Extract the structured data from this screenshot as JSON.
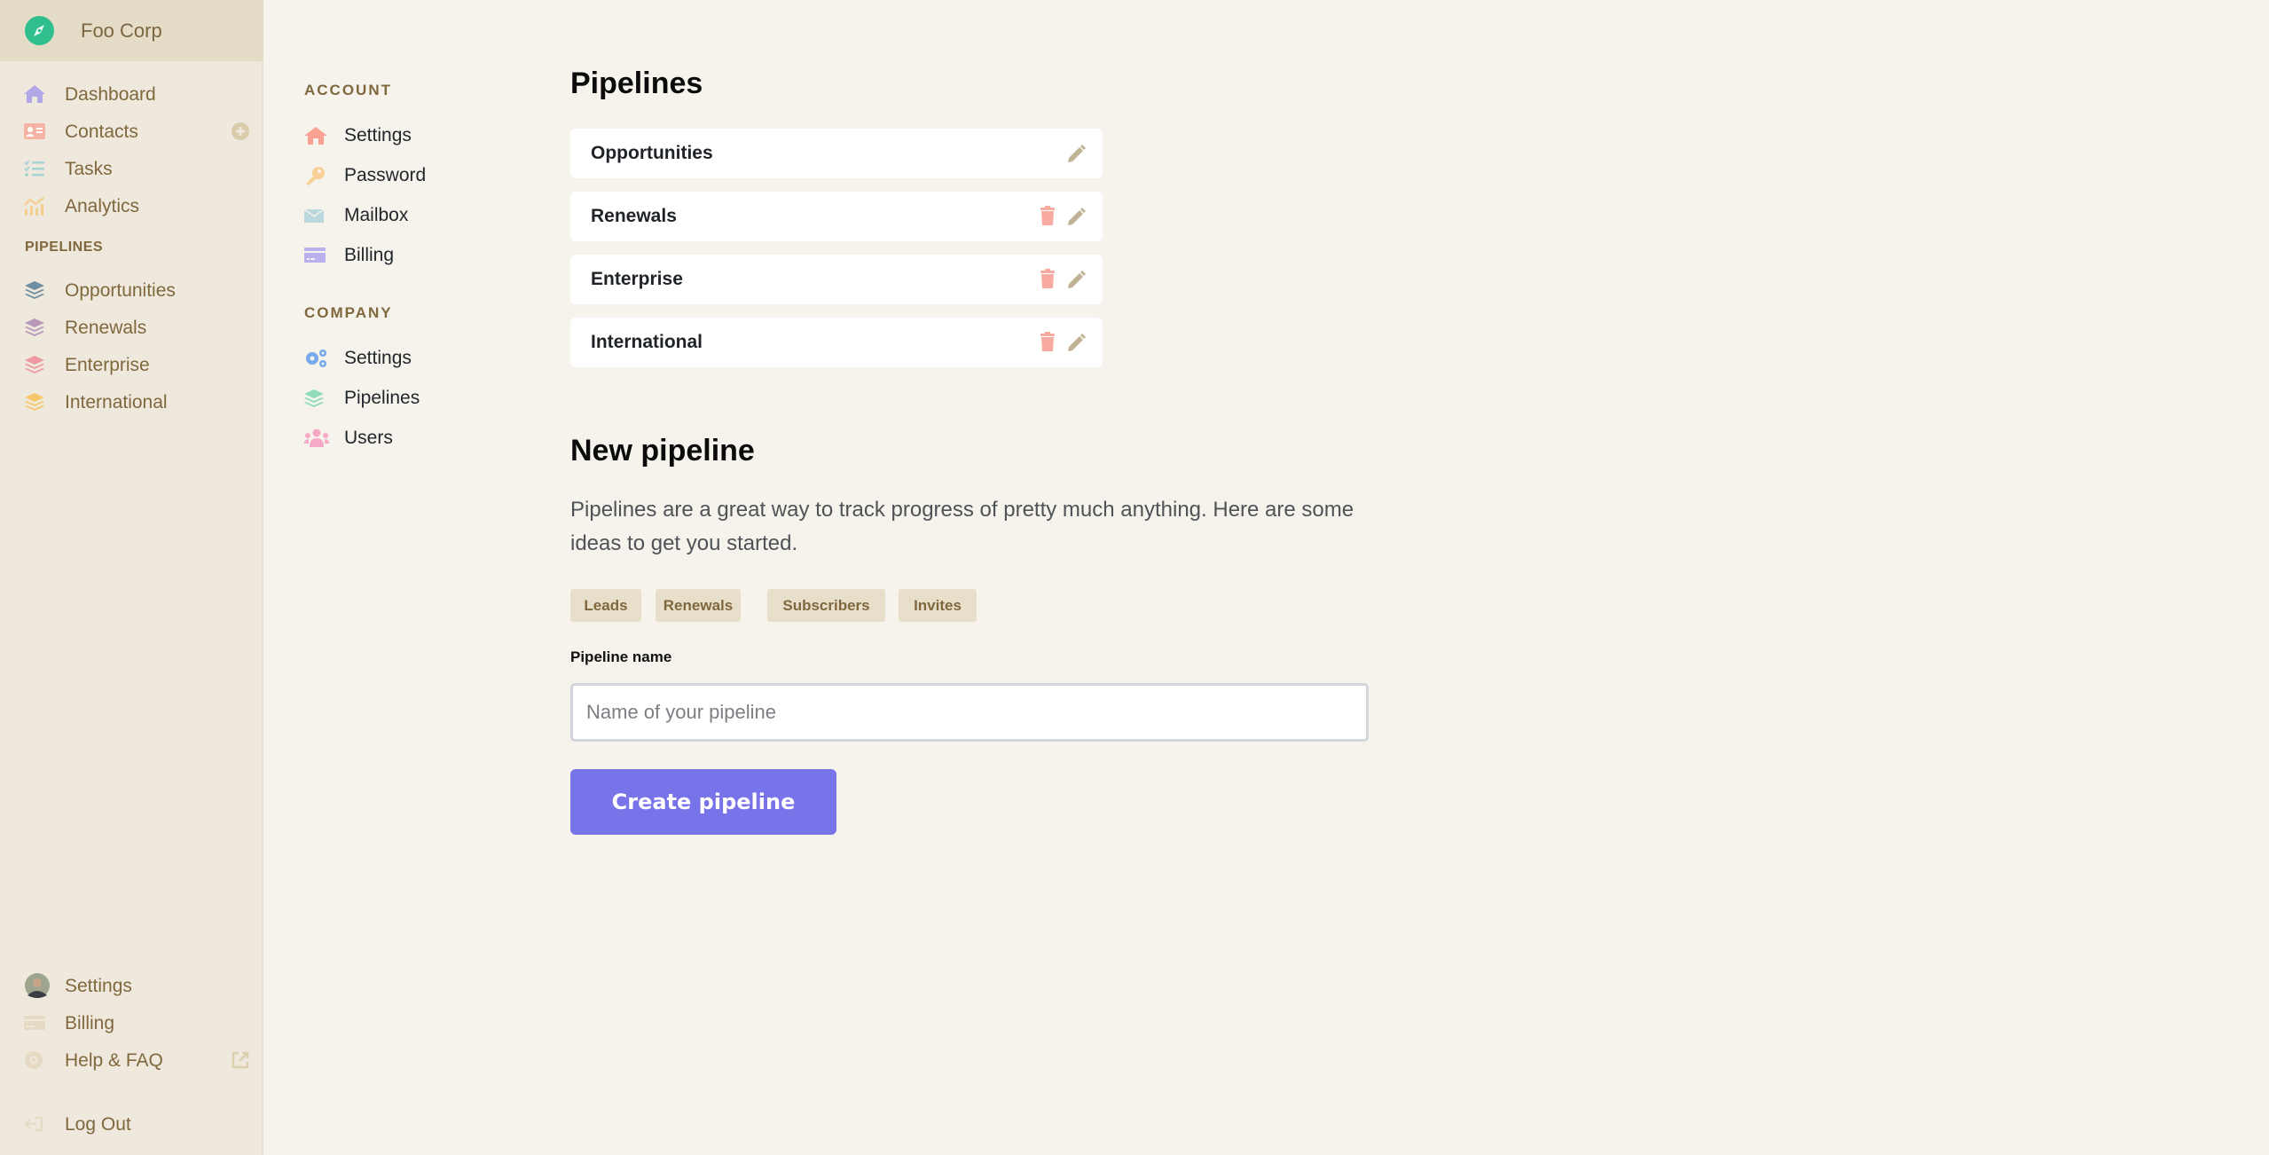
{
  "sidebar": {
    "brand": "Foo Corp",
    "nav": [
      {
        "label": "Dashboard",
        "icon": "home-icon"
      },
      {
        "label": "Contacts",
        "icon": "contact-card-icon",
        "trailing": "add-circle-icon"
      },
      {
        "label": "Tasks",
        "icon": "task-list-icon"
      },
      {
        "label": "Analytics",
        "icon": "analytics-chart-icon"
      }
    ],
    "pipelines_heading": "PIPELINES",
    "pipelines": [
      {
        "label": "Opportunities",
        "color": "#6e8fa3"
      },
      {
        "label": "Renewals",
        "color": "#b898b8"
      },
      {
        "label": "Enterprise",
        "color": "#ef9aa3"
      },
      {
        "label": "International",
        "color": "#f5c96b"
      }
    ],
    "footer": [
      {
        "label": "Settings",
        "icon": "avatar"
      },
      {
        "label": "Billing",
        "icon": "credit-card-icon"
      },
      {
        "label": "Help & FAQ",
        "icon": "lifebuoy-icon",
        "trailing": "external-link-icon"
      },
      {
        "label": "Log Out",
        "icon": "logout-icon"
      }
    ]
  },
  "subnav": {
    "account_heading": "ACCOUNT",
    "account": [
      {
        "label": "Settings",
        "icon": "home-icon"
      },
      {
        "label": "Password",
        "icon": "key-icon"
      },
      {
        "label": "Mailbox",
        "icon": "envelope-icon"
      },
      {
        "label": "Billing",
        "icon": "credit-card-icon"
      }
    ],
    "company_heading": "COMPANY",
    "company": [
      {
        "label": "Settings",
        "icon": "gears-icon"
      },
      {
        "label": "Pipelines",
        "icon": "layers-icon"
      },
      {
        "label": "Users",
        "icon": "users-icon"
      }
    ]
  },
  "main": {
    "title": "Pipelines",
    "pipelines": [
      {
        "name": "Opportunities",
        "deletable": false
      },
      {
        "name": "Renewals",
        "deletable": true
      },
      {
        "name": "Enterprise",
        "deletable": true
      },
      {
        "name": "International",
        "deletable": true
      }
    ],
    "new_title": "New pipeline",
    "description": "Pipelines are a great way to track progress of pretty much anything. Here are some ideas to get you started.",
    "suggestions": [
      "Leads",
      "Renewals",
      "Subscribers",
      "Invites"
    ],
    "field_label": "Pipeline name",
    "field_placeholder": "Name of your pipeline",
    "field_value": "",
    "submit_label": "Create pipeline"
  },
  "colors": {
    "accent": "#7873e8",
    "brand": "#2fbf8c",
    "sidebar_bg": "#efe8dc",
    "page_bg": "#f6f3ec",
    "danger": "#f8a9a0",
    "edit": "#bfb295"
  }
}
